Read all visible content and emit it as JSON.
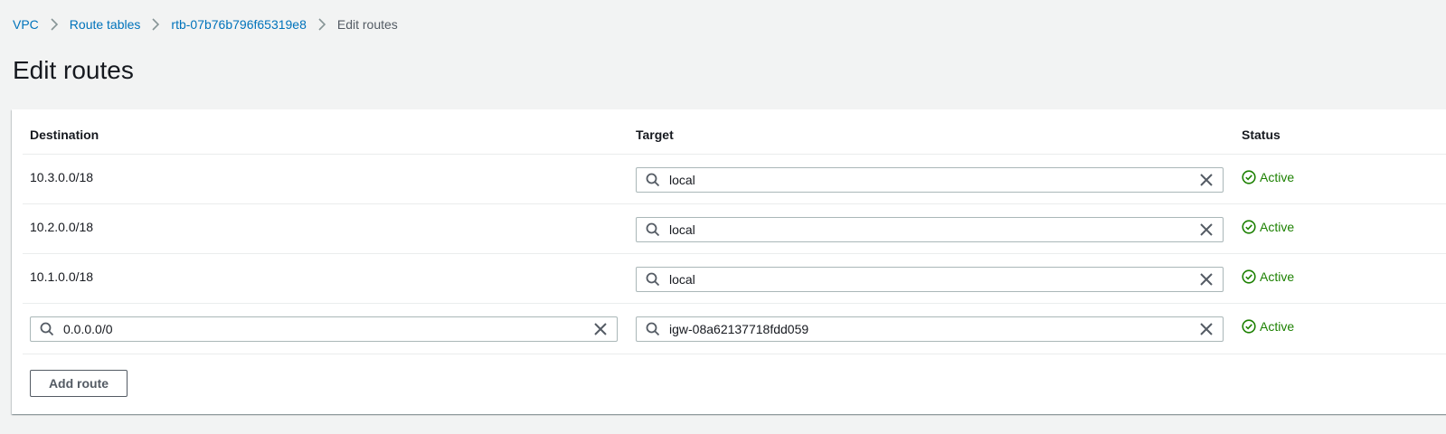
{
  "breadcrumb": {
    "items": [
      {
        "label": "VPC"
      },
      {
        "label": "Route tables"
      },
      {
        "label": "rtb-07b76b796f65319e8"
      }
    ],
    "current": "Edit routes"
  },
  "page": {
    "title": "Edit routes"
  },
  "table": {
    "headers": {
      "destination": "Destination",
      "target": "Target",
      "status": "Status"
    },
    "rows": [
      {
        "destination": "10.3.0.0/18",
        "target": "local",
        "status": "Active"
      },
      {
        "destination": "10.2.0.0/18",
        "target": "local",
        "status": "Active"
      },
      {
        "destination": "10.1.0.0/18",
        "target": "local",
        "status": "Active"
      },
      {
        "destination": "0.0.0.0/0",
        "target": "igw-08a62137718fdd059",
        "status": "Active"
      }
    ]
  },
  "actions": {
    "add_route_label": "Add route"
  },
  "icons": {
    "search": "search-icon",
    "clear": "close-icon",
    "status": "check-circle-icon",
    "separator": "chevron-right-icon"
  },
  "colors": {
    "link": "#0073bb",
    "status_active": "#1d8102",
    "background": "#f2f3f3",
    "border": "#aab7b8"
  }
}
